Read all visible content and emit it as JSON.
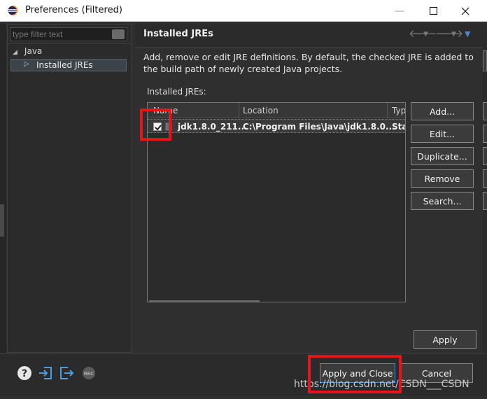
{
  "window": {
    "title": "Preferences (Filtered)"
  },
  "filter": {
    "placeholder": "type filter text"
  },
  "tree": {
    "root": "Java",
    "selected": "Installed JREs"
  },
  "page": {
    "title": "Installed JREs",
    "description": "Add, remove or edit JRE definitions. By default, the checked JRE is added to the build path of newly created Java projects.",
    "list_label": "Installed JREs:"
  },
  "table": {
    "columns": [
      "Name",
      "Location",
      "Typ"
    ],
    "rows": [
      {
        "checked": true,
        "name": "jdk1.8.0_211...",
        "location": "C:\\Program Files\\Java\\jdk1.8.0...",
        "type": "Sta"
      }
    ]
  },
  "buttons": {
    "add": "Add...",
    "edit": "Edit...",
    "duplicate": "Duplicate...",
    "remove": "Remove",
    "search": "Search...",
    "apply": "Apply",
    "apply_close": "Apply and Close",
    "cancel": "Cancel"
  },
  "watermark": "https://blog.csdn.net/CSDN___CSDN",
  "colors": {
    "highlight": "#e8141b",
    "accent": "#4a90d9",
    "background": "#2f2f2f"
  },
  "icons": [
    "eclipse-icon",
    "help-icon",
    "import-icon",
    "export-icon",
    "record-icon",
    "back-arrow-icon",
    "forward-arrow-icon",
    "view-menu-icon"
  ]
}
